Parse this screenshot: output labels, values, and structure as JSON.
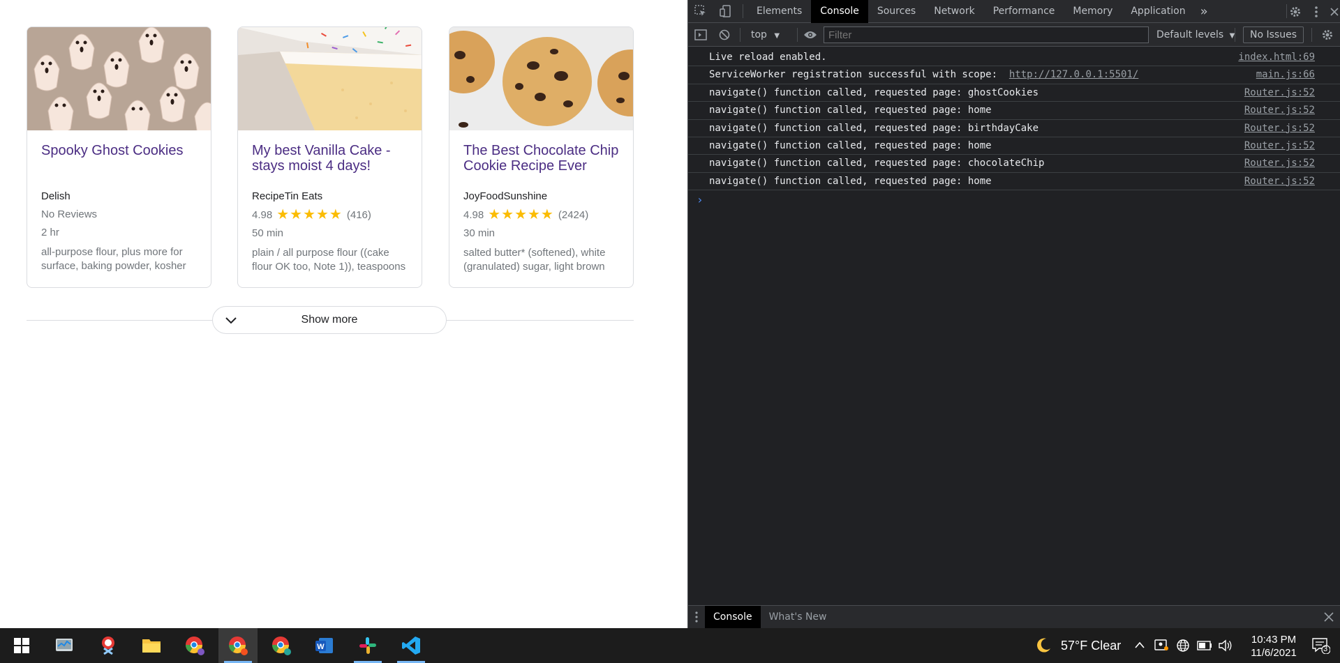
{
  "recipes": [
    {
      "title": "Spooky Ghost Cookies",
      "source": "Delish",
      "rating": "No Reviews",
      "stars": "",
      "count": "",
      "time": "2 hr",
      "ingredients": "all-purpose flour, plus more for surface, baking powder, kosher"
    },
    {
      "title": "My best Vanilla Cake - stays moist 4 days!",
      "source": "RecipeTin Eats",
      "rating": "4.98",
      "stars": "★★★★★",
      "count": "(416)",
      "time": "50 min",
      "ingredients": "plain / all purpose flour ((cake flour OK too, Note 1)), teaspoons"
    },
    {
      "title": "The Best Chocolate Chip Cookie Recipe Ever",
      "source": "JoyFoodSunshine",
      "rating": "4.98",
      "stars": "★★★★★",
      "count": "(2424)",
      "time": "30 min",
      "ingredients": "salted butter* (softened), white (granulated) sugar, light brown"
    }
  ],
  "show_more": "Show more",
  "devtools": {
    "tabs": [
      "Elements",
      "Console",
      "Sources",
      "Network",
      "Performance",
      "Memory",
      "Application"
    ],
    "active_tab": "Console",
    "more_tabs": "»",
    "context": "top",
    "filter_placeholder": "Filter",
    "levels": "Default levels",
    "issues": "No Issues",
    "logs": [
      {
        "msg": "Live reload enabled.",
        "link": "",
        "src": "index.html:69"
      },
      {
        "msg": "ServiceWorker registration successful with scope:  ",
        "link": "http://127.0.0.1:5501/",
        "src": "main.js:66"
      },
      {
        "msg": "navigate() function called, requested page: ghostCookies",
        "link": "",
        "src": "Router.js:52"
      },
      {
        "msg": "navigate() function called, requested page: home",
        "link": "",
        "src": "Router.js:52"
      },
      {
        "msg": "navigate() function called, requested page: birthdayCake",
        "link": "",
        "src": "Router.js:52"
      },
      {
        "msg": "navigate() function called, requested page: home",
        "link": "",
        "src": "Router.js:52"
      },
      {
        "msg": "navigate() function called, requested page: chocolateChip",
        "link": "",
        "src": "Router.js:52"
      },
      {
        "msg": "navigate() function called, requested page: home",
        "link": "",
        "src": "Router.js:52"
      }
    ],
    "prompt": "›",
    "drawer_tabs": [
      "Console",
      "What's New"
    ]
  },
  "taskbar": {
    "weather": "57°F  Clear",
    "time": "10:43 PM",
    "date": "11/6/2021",
    "notifications": "3"
  }
}
